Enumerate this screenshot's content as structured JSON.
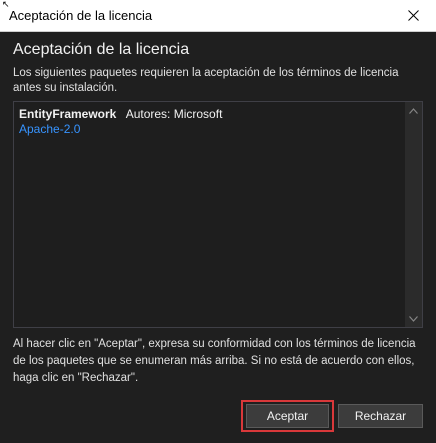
{
  "window": {
    "title": "Aceptación de la licencia"
  },
  "dialog": {
    "heading": "Aceptación de la licencia",
    "description": "Los siguientes paquetes requieren la aceptación de los términos de licencia antes su instalación.",
    "packages": [
      {
        "name": "EntityFramework",
        "authors": "Autores: Microsoft",
        "license": "Apache-2.0"
      }
    ],
    "footer": "Al hacer clic en \"Aceptar\", expresa su conformidad con los términos de licencia de los paquetes que se enumeran más arriba. Si no está de acuerdo con ellos, haga clic en \"Rechazar\".",
    "buttons": {
      "accept": "Aceptar",
      "reject": "Rechazar"
    }
  },
  "icons": {
    "close": "close-icon",
    "scroll_up": "chevron-up-icon",
    "scroll_down": "chevron-down-icon"
  },
  "colors": {
    "background": "#1f1f1f",
    "link": "#3794ff",
    "highlight": "#d9383a"
  }
}
